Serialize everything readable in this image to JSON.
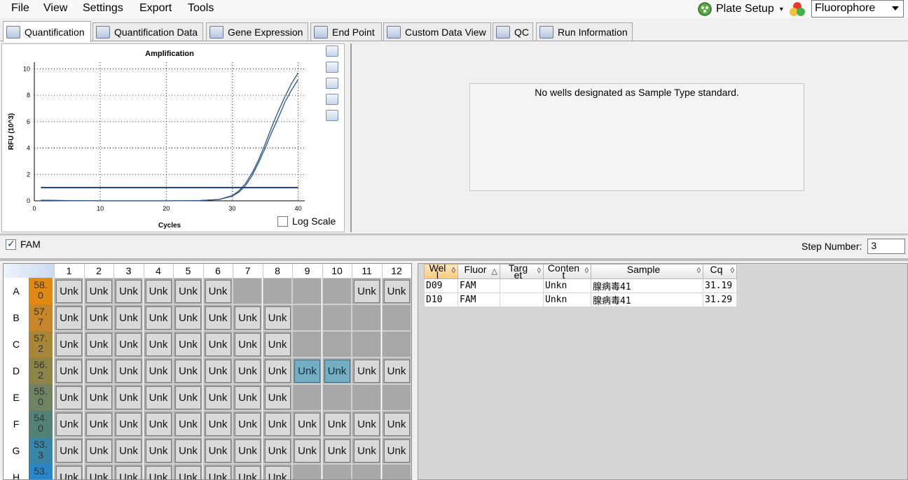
{
  "menu": [
    "File",
    "View",
    "Settings",
    "Export",
    "Tools"
  ],
  "toolbar": {
    "plate_setup_label": "Plate Setup",
    "fluorophore_value": "Fluorophore"
  },
  "tabs": [
    {
      "label": "Quantification",
      "active": true
    },
    {
      "label": "Quantification Data",
      "active": false
    },
    {
      "label": "Gene Expression",
      "active": false
    },
    {
      "label": "End Point",
      "active": false
    },
    {
      "label": "Custom Data View",
      "active": false
    },
    {
      "label": "QC",
      "active": false
    },
    {
      "label": "Run Information",
      "active": false
    }
  ],
  "chart_data": {
    "type": "line",
    "title": "Amplification",
    "xlabel": "Cycles",
    "ylabel": "RFU (10^3)",
    "xlim": [
      0,
      41
    ],
    "ylim": [
      0,
      10.5
    ],
    "xticks": [
      0,
      10,
      20,
      30,
      40
    ],
    "yticks": [
      0,
      2,
      4,
      6,
      8,
      10
    ],
    "grid": true,
    "threshold": 1.0,
    "threshold_color": "#1b3f6e",
    "series": [
      {
        "color": "#2b5584",
        "x": [
          1,
          5,
          10,
          15,
          20,
          25,
          28,
          30,
          31,
          32,
          33,
          34,
          35,
          36,
          37,
          38,
          39,
          40
        ],
        "y": [
          0.05,
          0.02,
          0.0,
          0.0,
          0.0,
          0.02,
          0.1,
          0.4,
          0.75,
          1.3,
          2.1,
          3.1,
          4.3,
          5.6,
          6.8,
          7.9,
          8.9,
          9.7
        ]
      },
      {
        "color": "#2b5584",
        "x": [
          1,
          5,
          10,
          15,
          20,
          25,
          28,
          30,
          31,
          32,
          33,
          34,
          35,
          36,
          37,
          38,
          39,
          40
        ],
        "y": [
          0.05,
          0.02,
          0.0,
          0.0,
          0.0,
          0.02,
          0.1,
          0.35,
          0.65,
          1.15,
          1.9,
          2.9,
          4.0,
          5.2,
          6.3,
          7.5,
          8.4,
          9.2
        ]
      }
    ]
  },
  "log_scale_label": "Log Scale",
  "std_message": "No wells designated as Sample Type standard.",
  "fam_label": "FAM",
  "step_number_label": "Step Number:",
  "step_number_value": "3",
  "plate": {
    "columns": [
      "1",
      "2",
      "3",
      "4",
      "5",
      "6",
      "7",
      "8",
      "9",
      "10",
      "11",
      "12"
    ],
    "rows": [
      {
        "label": "A",
        "temp": "58.\n0",
        "color": "#e08a14",
        "wells": [
          "Unk",
          "Unk",
          "Unk",
          "Unk",
          "Unk",
          "Unk",
          "",
          "",
          "",
          "",
          "Unk",
          "Unk"
        ]
      },
      {
        "label": "B",
        "temp": "57.\n7",
        "color": "#c6862a",
        "wells": [
          "Unk",
          "Unk",
          "Unk",
          "Unk",
          "Unk",
          "Unk",
          "Unk",
          "Unk",
          "",
          "",
          "",
          ""
        ]
      },
      {
        "label": "C",
        "temp": "57.\n2",
        "color": "#a88638",
        "wells": [
          "Unk",
          "Unk",
          "Unk",
          "Unk",
          "Unk",
          "Unk",
          "Unk",
          "Unk",
          "",
          "",
          "",
          ""
        ]
      },
      {
        "label": "D",
        "temp": "56.\n2",
        "color": "#8d844a",
        "wells": [
          "Unk",
          "Unk",
          "Unk",
          "Unk",
          "Unk",
          "Unk",
          "Unk",
          "Unk",
          "Unk",
          "Unk",
          "Unk",
          "Unk"
        ],
        "selected": [
          8,
          9
        ]
      },
      {
        "label": "E",
        "temp": "55.\n0",
        "color": "#6f8262",
        "wells": [
          "Unk",
          "Unk",
          "Unk",
          "Unk",
          "Unk",
          "Unk",
          "Unk",
          "Unk",
          "",
          "",
          "",
          ""
        ]
      },
      {
        "label": "F",
        "temp": "54.\n0",
        "color": "#538178",
        "wells": [
          "Unk",
          "Unk",
          "Unk",
          "Unk",
          "Unk",
          "Unk",
          "Unk",
          "Unk",
          "Unk",
          "Unk",
          "Unk",
          "Unk"
        ]
      },
      {
        "label": "G",
        "temp": "53.\n3",
        "color": "#3a84a6",
        "wells": [
          "Unk",
          "Unk",
          "Unk",
          "Unk",
          "Unk",
          "Unk",
          "Unk",
          "Unk",
          "Unk",
          "Unk",
          "Unk",
          "Unk"
        ]
      },
      {
        "label": "H",
        "temp": "53.",
        "color": "#2a86c6",
        "wells": [
          "Unk",
          "Unk",
          "Unk",
          "Unk",
          "Unk",
          "Unk",
          "Unk",
          "Unk",
          "",
          "",
          "",
          ""
        ]
      }
    ]
  },
  "results": {
    "headers": [
      "Wel\nl",
      "Fluor",
      "Targ\net",
      "Conten\nt",
      "Sample",
      "Cq"
    ],
    "rows": [
      [
        "D09",
        "FAM",
        "",
        "Unkn",
        "腺病毒41",
        "31.19"
      ],
      [
        "D10",
        "FAM",
        "",
        "Unkn",
        "腺病毒41",
        "31.29"
      ]
    ]
  }
}
